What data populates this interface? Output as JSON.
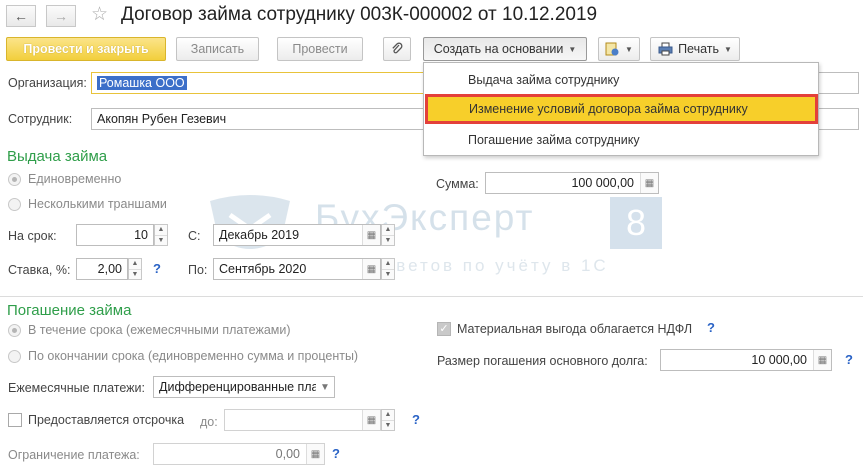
{
  "window": {
    "title": "Договор займа сотруднику 003К-000002 от 10.12.2019"
  },
  "toolbar": {
    "post_close": "Провести и закрыть",
    "save": "Записать",
    "post": "Провести",
    "create_based": "Создать на основании",
    "print": "Печать"
  },
  "dropdown": {
    "items": [
      "Выдача займа сотруднику",
      "Изменение условий договора займа сотруднику",
      "Погашение займа сотруднику"
    ]
  },
  "form": {
    "org_label": "Организация:",
    "org_value": "Ромашка ООО",
    "employee_label": "Сотрудник:",
    "employee_value": "Акопян Рубен Гезевич"
  },
  "issue": {
    "section": "Выдача займа",
    "once": "Единовременно",
    "tranches": "Несколькими траншами",
    "sum_label": "Сумма:",
    "sum_value": "100 000,00",
    "term_label": "На срок:",
    "term_value": "10",
    "from_label": "С:",
    "from_value": "Декабрь 2019",
    "rate_label": "Ставка, %:",
    "rate_value": "2,00",
    "to_label": "По:",
    "to_value": "Сентябрь 2020",
    "help": "?"
  },
  "repay": {
    "section": "Погашение займа",
    "during": "В течение срока (ежемесячными платежами)",
    "at_end": "По окончании срока (единовременно сумма и проценты)",
    "monthly_label": "Ежемесячные платежи:",
    "monthly_value": "Дифференцированные пла",
    "benefit_label": "Материальная выгода облагается НДФЛ",
    "principal_label": "Размер погашения основного долга:",
    "principal_value": "10 000,00",
    "deferral_label": "Предоставляется отсрочка",
    "until_label": "до:",
    "limit_label": "Ограничение платежа:",
    "limit_value": "0,00",
    "help": "?"
  },
  "watermark": {
    "title": "БухЭксперт",
    "digit": "8",
    "subtitle": "База ответов по учёту в 1С"
  },
  "colors": {
    "accent": "#f2cf3c",
    "section": "#2f9e4a",
    "selection": "#3c6fc9",
    "highlight_border": "#e3403a"
  }
}
